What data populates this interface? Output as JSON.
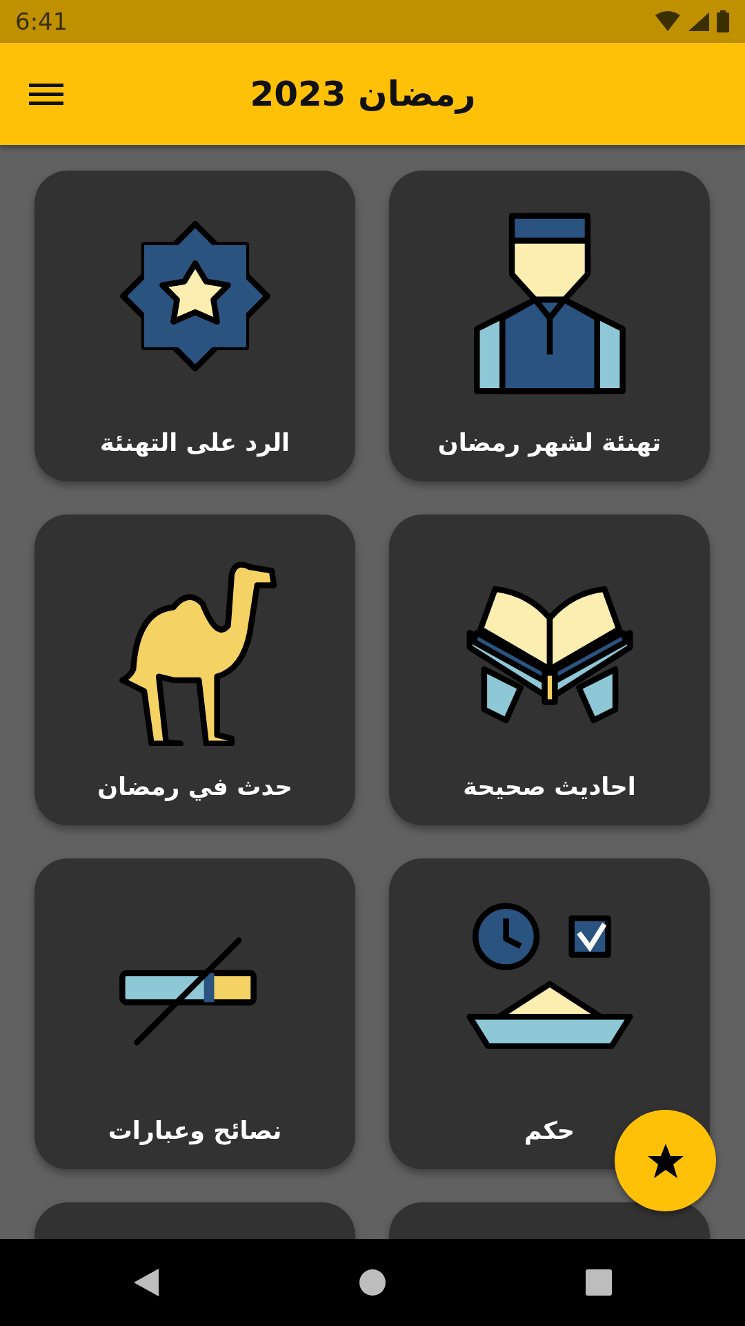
{
  "status_bar": {
    "time": "6:41"
  },
  "app_bar": {
    "title": "رمضان 2023"
  },
  "cards": [
    {
      "kind": "man",
      "label": "تهنئة لشهر رمضان"
    },
    {
      "kind": "star",
      "label": "الرد على التهنئة"
    },
    {
      "kind": "book",
      "label": "احاديث صحيحة"
    },
    {
      "kind": "camel",
      "label": "حدث في رمضان"
    },
    {
      "kind": "meal",
      "label": "حكم"
    },
    {
      "kind": "nosmoking",
      "label": "نصائح وعبارات"
    },
    {
      "kind": "cut"
    },
    {
      "kind": "cut"
    }
  ]
}
